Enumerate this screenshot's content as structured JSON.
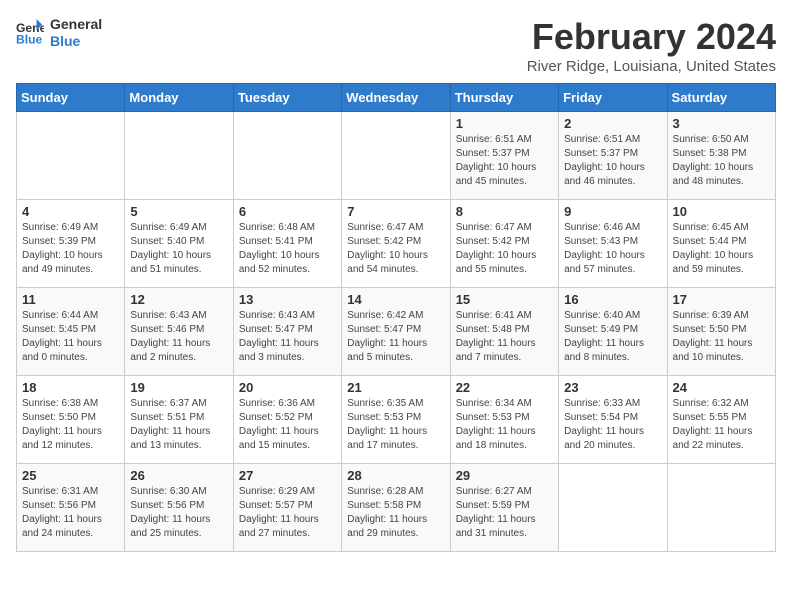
{
  "logo": {
    "line1": "General",
    "line2": "Blue"
  },
  "title": "February 2024",
  "subtitle": "River Ridge, Louisiana, United States",
  "days_of_week": [
    "Sunday",
    "Monday",
    "Tuesday",
    "Wednesday",
    "Thursday",
    "Friday",
    "Saturday"
  ],
  "weeks": [
    [
      {
        "day": "",
        "info": ""
      },
      {
        "day": "",
        "info": ""
      },
      {
        "day": "",
        "info": ""
      },
      {
        "day": "",
        "info": ""
      },
      {
        "day": "1",
        "info": "Sunrise: 6:51 AM\nSunset: 5:37 PM\nDaylight: 10 hours\nand 45 minutes."
      },
      {
        "day": "2",
        "info": "Sunrise: 6:51 AM\nSunset: 5:37 PM\nDaylight: 10 hours\nand 46 minutes."
      },
      {
        "day": "3",
        "info": "Sunrise: 6:50 AM\nSunset: 5:38 PM\nDaylight: 10 hours\nand 48 minutes."
      }
    ],
    [
      {
        "day": "4",
        "info": "Sunrise: 6:49 AM\nSunset: 5:39 PM\nDaylight: 10 hours\nand 49 minutes."
      },
      {
        "day": "5",
        "info": "Sunrise: 6:49 AM\nSunset: 5:40 PM\nDaylight: 10 hours\nand 51 minutes."
      },
      {
        "day": "6",
        "info": "Sunrise: 6:48 AM\nSunset: 5:41 PM\nDaylight: 10 hours\nand 52 minutes."
      },
      {
        "day": "7",
        "info": "Sunrise: 6:47 AM\nSunset: 5:42 PM\nDaylight: 10 hours\nand 54 minutes."
      },
      {
        "day": "8",
        "info": "Sunrise: 6:47 AM\nSunset: 5:42 PM\nDaylight: 10 hours\nand 55 minutes."
      },
      {
        "day": "9",
        "info": "Sunrise: 6:46 AM\nSunset: 5:43 PM\nDaylight: 10 hours\nand 57 minutes."
      },
      {
        "day": "10",
        "info": "Sunrise: 6:45 AM\nSunset: 5:44 PM\nDaylight: 10 hours\nand 59 minutes."
      }
    ],
    [
      {
        "day": "11",
        "info": "Sunrise: 6:44 AM\nSunset: 5:45 PM\nDaylight: 11 hours\nand 0 minutes."
      },
      {
        "day": "12",
        "info": "Sunrise: 6:43 AM\nSunset: 5:46 PM\nDaylight: 11 hours\nand 2 minutes."
      },
      {
        "day": "13",
        "info": "Sunrise: 6:43 AM\nSunset: 5:47 PM\nDaylight: 11 hours\nand 3 minutes."
      },
      {
        "day": "14",
        "info": "Sunrise: 6:42 AM\nSunset: 5:47 PM\nDaylight: 11 hours\nand 5 minutes."
      },
      {
        "day": "15",
        "info": "Sunrise: 6:41 AM\nSunset: 5:48 PM\nDaylight: 11 hours\nand 7 minutes."
      },
      {
        "day": "16",
        "info": "Sunrise: 6:40 AM\nSunset: 5:49 PM\nDaylight: 11 hours\nand 8 minutes."
      },
      {
        "day": "17",
        "info": "Sunrise: 6:39 AM\nSunset: 5:50 PM\nDaylight: 11 hours\nand 10 minutes."
      }
    ],
    [
      {
        "day": "18",
        "info": "Sunrise: 6:38 AM\nSunset: 5:50 PM\nDaylight: 11 hours\nand 12 minutes."
      },
      {
        "day": "19",
        "info": "Sunrise: 6:37 AM\nSunset: 5:51 PM\nDaylight: 11 hours\nand 13 minutes."
      },
      {
        "day": "20",
        "info": "Sunrise: 6:36 AM\nSunset: 5:52 PM\nDaylight: 11 hours\nand 15 minutes."
      },
      {
        "day": "21",
        "info": "Sunrise: 6:35 AM\nSunset: 5:53 PM\nDaylight: 11 hours\nand 17 minutes."
      },
      {
        "day": "22",
        "info": "Sunrise: 6:34 AM\nSunset: 5:53 PM\nDaylight: 11 hours\nand 18 minutes."
      },
      {
        "day": "23",
        "info": "Sunrise: 6:33 AM\nSunset: 5:54 PM\nDaylight: 11 hours\nand 20 minutes."
      },
      {
        "day": "24",
        "info": "Sunrise: 6:32 AM\nSunset: 5:55 PM\nDaylight: 11 hours\nand 22 minutes."
      }
    ],
    [
      {
        "day": "25",
        "info": "Sunrise: 6:31 AM\nSunset: 5:56 PM\nDaylight: 11 hours\nand 24 minutes."
      },
      {
        "day": "26",
        "info": "Sunrise: 6:30 AM\nSunset: 5:56 PM\nDaylight: 11 hours\nand 25 minutes."
      },
      {
        "day": "27",
        "info": "Sunrise: 6:29 AM\nSunset: 5:57 PM\nDaylight: 11 hours\nand 27 minutes."
      },
      {
        "day": "28",
        "info": "Sunrise: 6:28 AM\nSunset: 5:58 PM\nDaylight: 11 hours\nand 29 minutes."
      },
      {
        "day": "29",
        "info": "Sunrise: 6:27 AM\nSunset: 5:59 PM\nDaylight: 11 hours\nand 31 minutes."
      },
      {
        "day": "",
        "info": ""
      },
      {
        "day": "",
        "info": ""
      }
    ]
  ]
}
